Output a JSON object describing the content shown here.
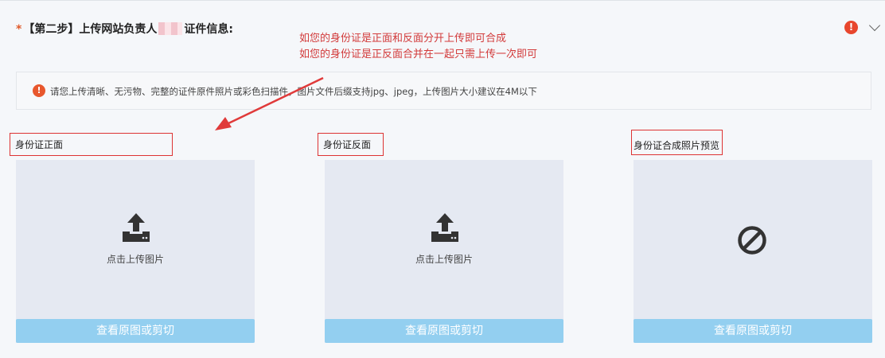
{
  "step": {
    "required_mark": "*",
    "title_prefix": "【第二步】上传网站负责人",
    "title_suffix": "证件信息:"
  },
  "annotation": {
    "line1": "如您的身份证是正面和反面分开上传即可合成",
    "line2": "如您的身份证是正反面合并在一起只需上传一次即可"
  },
  "notice": {
    "text": "请您上传清晰、无污物、完整的证件原件照片或彩色扫描件，图片文件后缀支持jpg、jpeg，上传图片大小建议在4M以下"
  },
  "panels": [
    {
      "label": "身份证正面",
      "upload_text": "点击上传图片",
      "button": "查看原图或剪切"
    },
    {
      "label": "身份证反面",
      "upload_text": "点击上传图片",
      "button": "查看原图或剪切"
    },
    {
      "label": "身份证合成照片预览",
      "button": "查看原图或剪切"
    }
  ],
  "icons": {
    "alert": "exclamation-circle-icon",
    "collapse": "chevron-down-icon",
    "upload": "upload-icon",
    "preview_unavailable": "ban-icon"
  },
  "colors": {
    "annotation": "#d23a3a",
    "alert": "#e8462d",
    "button": "#93cff0",
    "panel": "#e5e9f2"
  }
}
